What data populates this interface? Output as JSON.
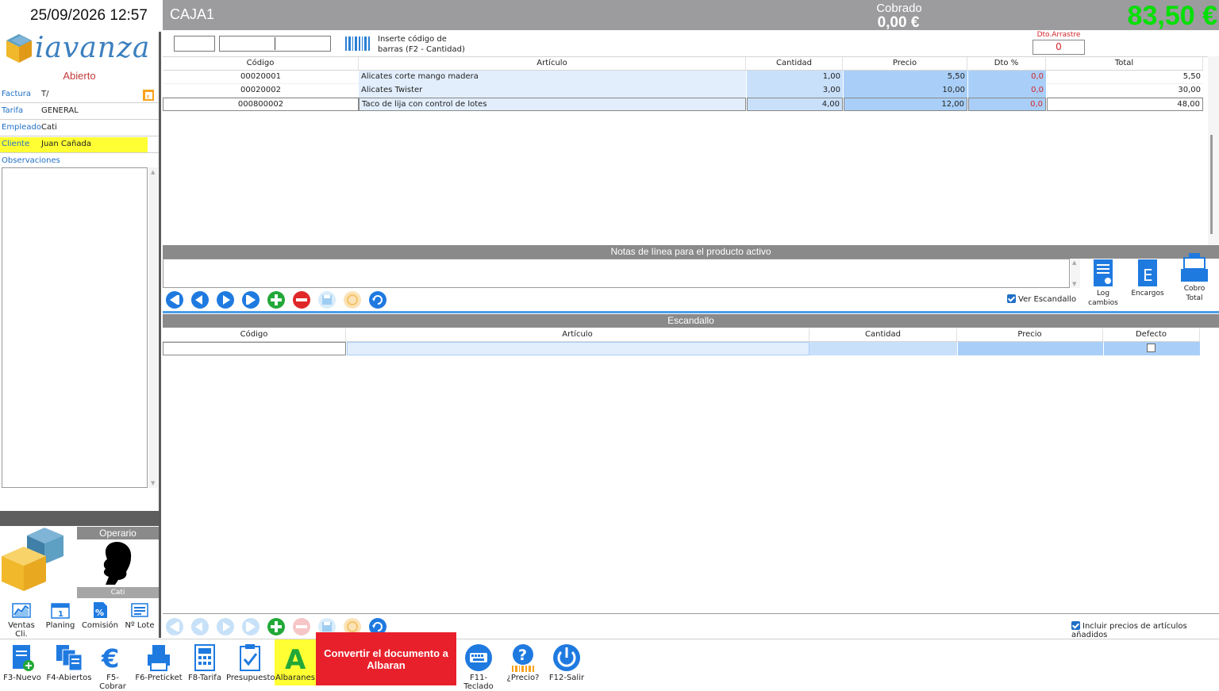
{
  "header": {
    "datetime": "25/09/2026 12:57",
    "caja": "CAJA1",
    "cobrado_label": "Cobrado",
    "cobrado_value": "0,00 €",
    "total_value": "83,50 €"
  },
  "sidebar": {
    "logo_text": "iavanza",
    "status": "Abierto",
    "rows": [
      {
        "label": "Factura",
        "value": "T/"
      },
      {
        "label": "Tarifa",
        "value": "GENERAL"
      },
      {
        "label": "Empleado",
        "value": "Cati"
      },
      {
        "label": "Cliente",
        "value": "Juan Cañada"
      }
    ],
    "observaciones_label": "Observaciones",
    "operario_title": "Operario",
    "operario_name": "Cati",
    "tools": [
      {
        "label": "Ventas Cli.",
        "icon": "chart-icon"
      },
      {
        "label": "Planing",
        "icon": "calendar-icon"
      },
      {
        "label": "Comisión",
        "icon": "percent-doc-icon"
      },
      {
        "label": "Nº Lote",
        "icon": "lot-icon"
      }
    ]
  },
  "entry": {
    "barcode_hint_line1": "Inserte código de",
    "barcode_hint_line2": "barras (F2 - Cantidad)",
    "dto_label": "Dto.Arrastre",
    "dto_value": "0"
  },
  "lines": {
    "columns": [
      "Código",
      "Artículo",
      "Cantidad",
      "Precio",
      "Dto %",
      "Total"
    ],
    "rows": [
      {
        "codigo": "00020001",
        "articulo": "Alicates corte mango madera",
        "cantidad": "1,00",
        "precio": "5,50",
        "dto": "0,0",
        "total": "5,50"
      },
      {
        "codigo": "00020002",
        "articulo": "Alicates Twister",
        "cantidad": "3,00",
        "precio": "10,00",
        "dto": "0,0",
        "total": "30,00"
      },
      {
        "codigo": "000800002",
        "articulo": "Taco de lija con control de lotes",
        "cantidad": "4,00",
        "precio": "12,00",
        "dto": "0,0",
        "total": "48,00"
      }
    ]
  },
  "notes": {
    "title": "Notas de línea para el producto activo"
  },
  "side_tools": [
    {
      "label": "Log cambios",
      "icon": "log-icon"
    },
    {
      "label": "Encargos",
      "icon": "encargos-icon"
    },
    {
      "label": "Cobro Total",
      "icon": "register-icon"
    }
  ],
  "ver_escandallo": "Ver Escandallo",
  "escandallo": {
    "title": "Escandallo",
    "columns": [
      "Código",
      "Artículo",
      "Cantidad",
      "Precio",
      "Defecto"
    ]
  },
  "incluir_precios": "Incluir precios de artículos añadidos",
  "bottom_tools": [
    {
      "label": "F3-Nuevo",
      "icon": "new-doc-icon"
    },
    {
      "label": "F4-Abiertos",
      "icon": "open-docs-icon"
    },
    {
      "label": "F5-Cobrar",
      "icon": "euro-icon"
    },
    {
      "label": "F6-Preticket",
      "icon": "printer-icon"
    },
    {
      "label": "F8-Tarifa",
      "icon": "calculator-icon"
    },
    {
      "label": "Presupuesto",
      "icon": "clipboard-check-icon"
    },
    {
      "label": "Albaranes",
      "icon": "letter-a-icon"
    },
    {
      "label": "F11-Teclado",
      "icon": "keyboard-icon"
    },
    {
      "label": "¿Precio?",
      "icon": "price-question-icon"
    },
    {
      "label": "F12-Salir",
      "icon": "power-icon"
    }
  ],
  "convertir_label": "Convertir el documento a Albaran",
  "colors": {
    "topbar": "#9c9c9e",
    "total_green": "#00e000",
    "highlight_yellow": "#ffff33",
    "cell_blue": "#b7d7fb",
    "cell_lightblue": "#e2eefc",
    "red_button": "#e8202b",
    "nav_blue": "#1f7ae0",
    "nav_green": "#22a838",
    "nav_red": "#e0282b"
  }
}
